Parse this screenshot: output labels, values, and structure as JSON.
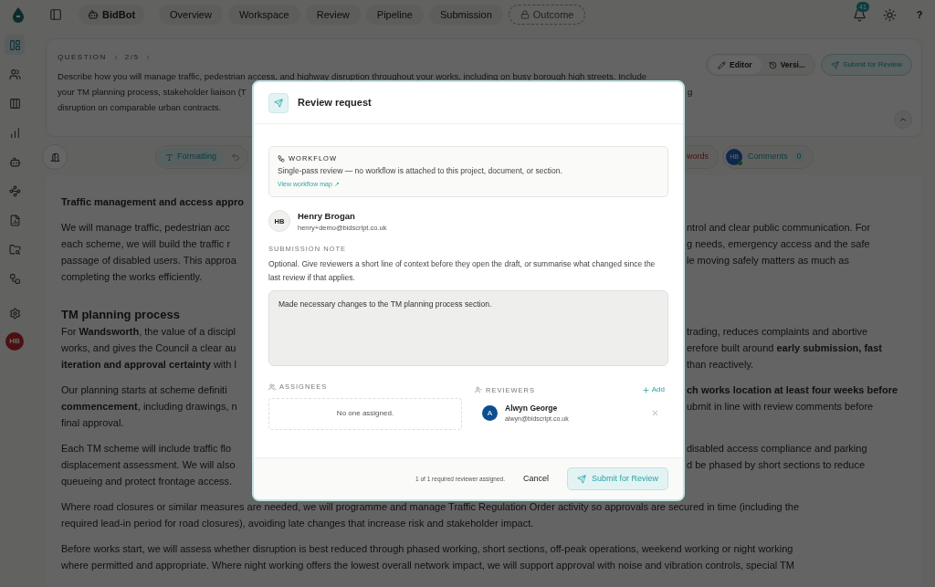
{
  "top_bar": {
    "brand": "BidBot",
    "nav": [
      {
        "label": "Overview",
        "locked": false
      },
      {
        "label": "Workspace",
        "locked": false
      },
      {
        "label": "Review",
        "locked": false
      },
      {
        "label": "Pipeline",
        "locked": false
      },
      {
        "label": "Submission",
        "locked": false
      },
      {
        "label": "Outcome",
        "locked": true
      }
    ],
    "notification_count": "41",
    "help": "?"
  },
  "sidebar": {
    "items": [
      {
        "selected": true
      },
      {
        "selected": false
      },
      {
        "selected": false
      },
      {
        "selected": false
      },
      {
        "selected": false
      },
      {
        "selected": false
      },
      {
        "selected": false
      },
      {
        "selected": false
      },
      {
        "selected": false
      },
      {
        "selected": false
      }
    ],
    "avatar": "HB"
  },
  "question": {
    "label": "QUESTION",
    "position": "2/5",
    "lines": [
      {
        "left": "Describe how you will manage traffic, pedestrian access, and highway disruption throughout your works, including on busy borough high streets. Include"
      },
      {
        "left": "your TM planning process, stakeholder liaison (T",
        "right": "g"
      },
      {
        "left": "disruption on comparable urban contracts."
      }
    ],
    "actions": {
      "editor": "Editor",
      "versions": "Versi...",
      "submit": "Submit for Review"
    }
  },
  "toolbar": {
    "formatting": "Formatting",
    "word_count": "words",
    "comments_avatar": "HB",
    "comments": "Comments",
    "comments_count": "0"
  },
  "document": {
    "blocks": [
      {
        "kind": "subheading",
        "lines": [
          {
            "left": "Traffic management and access appro"
          }
        ]
      },
      {
        "kind": "paragraph",
        "lines": [
          {
            "left": "We will manage traffic, pedestrian acc",
            "right": "ntrol and clear public communication. For"
          },
          {
            "left": "each scheme, we will build the traffic r",
            "right": "g needs, emergency access and the safe"
          },
          {
            "left": "passage of disabled users. This approa",
            "right": "le moving safely matters as much as"
          },
          {
            "left": "completing the works efficiently."
          }
        ]
      },
      {
        "kind": "heading",
        "lines": [
          {
            "left": "TM planning process"
          }
        ]
      },
      {
        "kind": "paragraph",
        "lines": [
          {
            "left": "For **Wandsworth**, the value of a discipl",
            "right": "trading, reduces complaints and abortive"
          },
          {
            "left": "works, and gives the Council a clear au",
            "right": "erefore built around **early submission, fast**"
          },
          {
            "left": "**iteration and approval certainty** with l",
            "right": "than reactively."
          }
        ]
      },
      {
        "kind": "paragraph",
        "lines": [
          {
            "left": "Our planning starts at scheme definiti",
            "right": "**ch works location at least four weeks before**"
          },
          {
            "left": "**commencement**, including drawings, n",
            "right": "ubmit in line with review comments before"
          },
          {
            "left": "final approval."
          }
        ]
      },
      {
        "kind": "paragraph",
        "lines": [
          {
            "left": "Each TM scheme will include traffic flo",
            "right": "disabled access compliance and parking"
          },
          {
            "left": "displacement assessment. We will also",
            "right": "d be phased by short sections to reduce"
          },
          {
            "left": "queueing and protect frontage access."
          }
        ]
      },
      {
        "kind": "paragraph",
        "lines": [
          {
            "left": "Where road closures or similar measures are needed, we will programme and manage Traffic Regulation Order activity so approvals are secured in time (including the"
          },
          {
            "left": "required lead-in period for road closures), avoiding late changes that increase risk and stakeholder impact."
          }
        ]
      },
      {
        "kind": "paragraph",
        "lines": [
          {
            "left": "Before works start, we will assess whether disruption is best reduced through phased working, short sections, off-peak operations, weekend working or night working"
          },
          {
            "left": "where permitted and appropriate. Where night working offers the lowest overall network impact, we will support approval with noise and vibration controls, special TM"
          }
        ]
      }
    ]
  },
  "dialog": {
    "title": "Review request",
    "workflow": {
      "label": "WORKFLOW",
      "text": "Single-pass review — no workflow is attached to this project, document, or section.",
      "link": "View workflow map ↗"
    },
    "submitter": {
      "initials": "HB",
      "name": "Henry Brogan",
      "email": "henry+demo@bidscript.co.uk"
    },
    "note": {
      "label": "SUBMISSION NOTE",
      "help": "Optional. Give reviewers a short line of context before they open the draft, or summarise what changed since the last review if that applies.",
      "value": "Made necessary changes to the TM planning process section."
    },
    "assignees": {
      "label": "ASSIGNEES",
      "empty": "No one assigned."
    },
    "reviewers": {
      "label": "REVIEWERS",
      "add": "Add",
      "people": [
        {
          "initial": "A",
          "name": "Alwyn George",
          "email": "alwyn@bidscript.co.uk",
          "color": "#0b4f8f"
        }
      ]
    },
    "status": "1 of 1 required reviewer assigned.",
    "cancel": "Cancel",
    "submit": "Submit for Review"
  }
}
